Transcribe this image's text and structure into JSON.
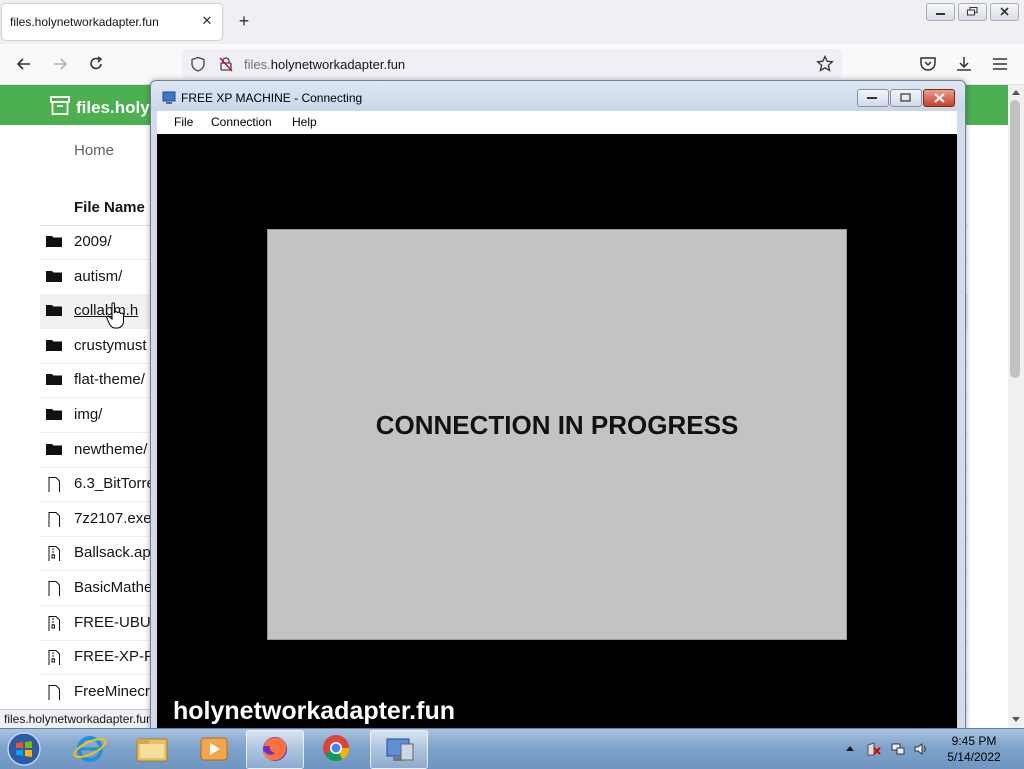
{
  "browser": {
    "tab_title": "files.holynetworkadapter.fun",
    "url_prefix": "files.",
    "url_domain": "holynetworkadapter.fun",
    "status_text": "files.holynetworkadapter.fun"
  },
  "page": {
    "site_title": "files.holyr",
    "home_label": "Home",
    "column_header": "File Name",
    "files": [
      {
        "name": "2009/",
        "icon": "folder-icon"
      },
      {
        "name": "autism/",
        "icon": "folder-icon"
      },
      {
        "name": "collab​m.h",
        "icon": "folder-icon"
      },
      {
        "name": "crustymust",
        "icon": "folder-icon"
      },
      {
        "name": "flat-theme/",
        "icon": "folder-icon"
      },
      {
        "name": "img/",
        "icon": "folder-icon"
      },
      {
        "name": "newtheme/",
        "icon": "folder-icon"
      },
      {
        "name": "6.3_BitTorre",
        "icon": "file-icon"
      },
      {
        "name": "7z2107.exe",
        "icon": "file-icon"
      },
      {
        "name": "Ballsack.ap",
        "icon": "archive-icon"
      },
      {
        "name": "BasicMathe",
        "icon": "file-icon"
      },
      {
        "name": "FREE-UBUN",
        "icon": "archive-icon"
      },
      {
        "name": "FREE-XP-PC",
        "icon": "archive-icon"
      },
      {
        "name": "FreeMinecr",
        "icon": "file-icon"
      }
    ]
  },
  "xp_window": {
    "title": "FREE XP MACHINE - Connecting",
    "menus": [
      "File",
      "Connection",
      "Help"
    ],
    "connection_text": "CONNECTION IN PROGRESS",
    "watermark": "holynetworkadapter.fun"
  },
  "taskbar": {
    "time": "9:45 PM",
    "date": "5/14/2022"
  },
  "colors": {
    "site_header": "#4caf50",
    "connection_box": "#c3c3c3",
    "remote_screen": "#000000"
  }
}
